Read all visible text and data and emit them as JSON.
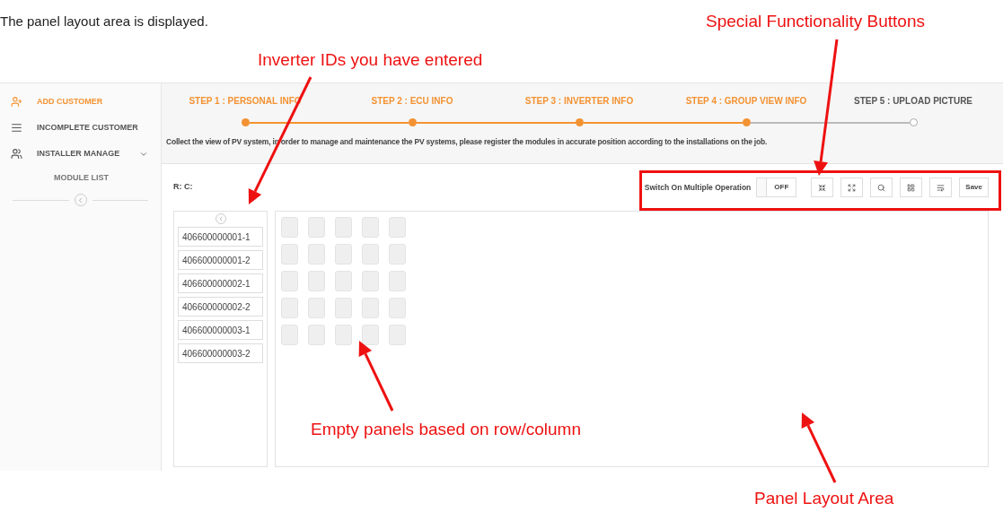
{
  "caption": "The panel layout area is displayed.",
  "annotations": [
    {
      "text": "Special Functionality Buttons"
    },
    {
      "text": "Inverter IDs you have entered"
    },
    {
      "text": "Empty panels based on row/column"
    },
    {
      "text": "Panel Layout Area"
    }
  ],
  "sidebar": {
    "items": [
      {
        "label": "ADD CUSTOMER",
        "kind": "add",
        "selected": true,
        "expandable": false
      },
      {
        "label": "INCOMPLETE CUSTOMER",
        "kind": "list",
        "selected": false,
        "expandable": false
      },
      {
        "label": "INSTALLER MANAGE",
        "kind": "users",
        "selected": false,
        "expandable": true,
        "children": [
          {
            "label": "MODULE LIST"
          }
        ]
      }
    ]
  },
  "steps": [
    {
      "label": "STEP 1 : PERSONAL INFO",
      "completed": true
    },
    {
      "label": "STEP 2 : ECU INFO",
      "completed": true
    },
    {
      "label": "STEP 3 : INVERTER INFO",
      "completed": true
    },
    {
      "label": "STEP 4 : GROUP VIEW INFO",
      "completed": true
    },
    {
      "label": "STEP 5 : UPLOAD PICTURE",
      "completed": false
    }
  ],
  "description": "Collect the view of PV system, in order to manage and maintenance the PV systems, please register the modules in accurate position according to the installations on the job.",
  "position_label": "R: C:",
  "toolbar": {
    "multiple_label": "Switch On Multiple Operation",
    "toggle": {
      "label": "OFF",
      "on": false
    },
    "buttons": [
      {
        "kind": "shrink"
      },
      {
        "kind": "expand"
      },
      {
        "kind": "search"
      },
      {
        "kind": "grid"
      },
      {
        "kind": "wrap"
      },
      {
        "kind": "text",
        "label": "Save"
      }
    ]
  },
  "inverter_ids": [
    "406600000001-1",
    "406600000001-2",
    "406600000002-1",
    "406600000002-2",
    "406600000003-1",
    "406600000003-2"
  ],
  "panel_grid": [
    [
      {
        "filled": false
      },
      {
        "filled": false
      },
      {
        "filled": false
      },
      {
        "filled": false
      },
      {
        "filled": false
      }
    ],
    [
      {
        "filled": false
      },
      {
        "filled": false
      },
      {
        "filled": false
      },
      {
        "filled": false
      },
      {
        "filled": false
      }
    ],
    [
      {
        "filled": false
      },
      {
        "filled": false
      },
      {
        "filled": false
      },
      {
        "filled": false
      },
      {
        "filled": false
      }
    ],
    [
      {
        "filled": false
      },
      {
        "filled": false
      },
      {
        "filled": false
      },
      {
        "filled": false
      },
      {
        "filled": false
      }
    ],
    [
      {
        "filled": false
      },
      {
        "filled": false
      },
      {
        "filled": false
      },
      {
        "filled": false
      },
      {
        "filled": false
      }
    ]
  ]
}
